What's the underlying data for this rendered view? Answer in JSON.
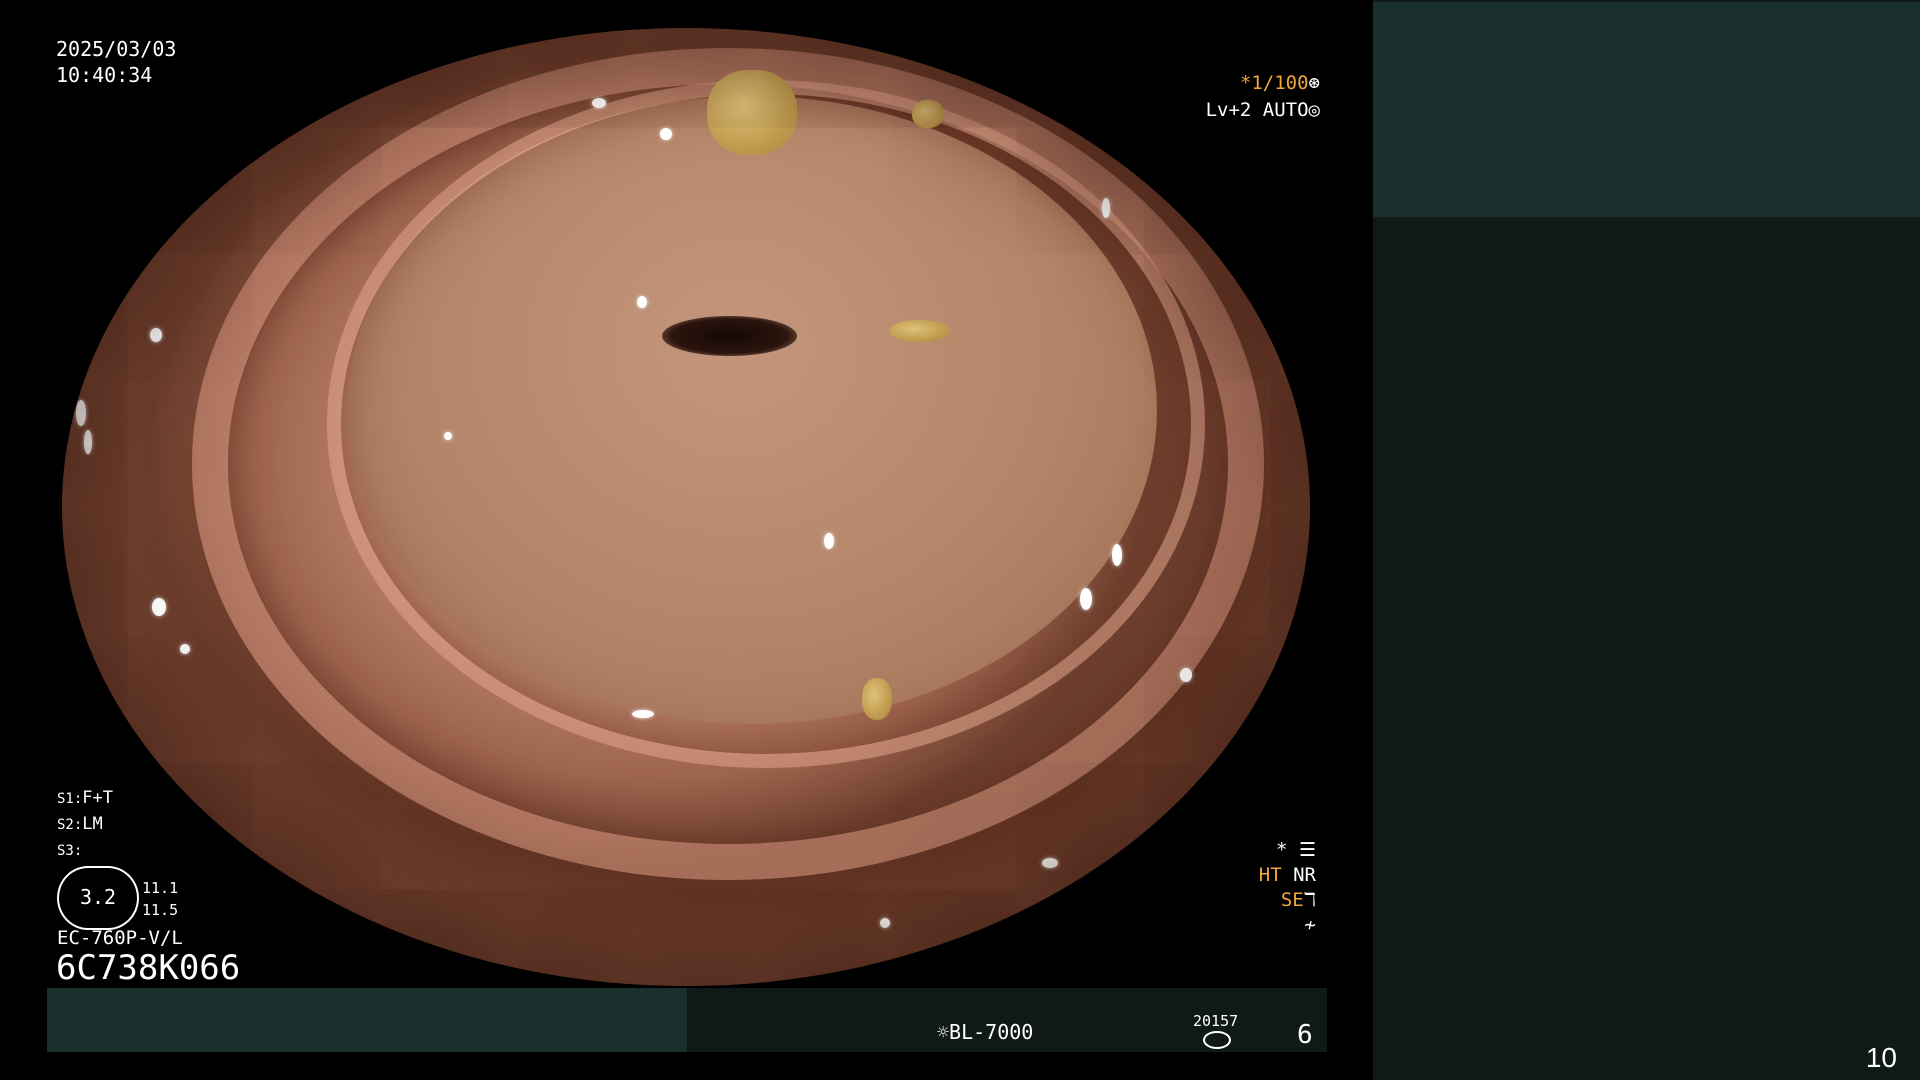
{
  "overlay": {
    "date": "2025/03/03",
    "time": "10:40:34",
    "shutter": "*1/100",
    "level": "Lv+2",
    "auto": "AUTO",
    "s1_key": "S1:",
    "s1_val": "F+T",
    "s2_key": "S2:",
    "s2_val": "LM",
    "s3_key": "S3:",
    "s3_val": "",
    "zoom_value": "3.2",
    "zoom_sub1": "11.1",
    "zoom_sub2": "11.5",
    "model": "EC-760P-V/L",
    "serial": "6C738K066",
    "star": "*",
    "ht": "HT",
    "nr": "NR",
    "se": "SE"
  },
  "bottom_bar": {
    "light_source": "BL-7000",
    "counter": "20157",
    "frame_number": "6"
  },
  "right_panel": {
    "page_number": "10"
  },
  "colors": {
    "accent_orange": "#f0a63a",
    "panel_dark": "#0f1a18",
    "panel_teal": "#19302c"
  },
  "icons": [
    "shutter-icon",
    "auto-iris-icon",
    "menu-list-icon",
    "structure-enhance-icon",
    "color-tone-icon",
    "light-source-icon",
    "disk-icon"
  ]
}
